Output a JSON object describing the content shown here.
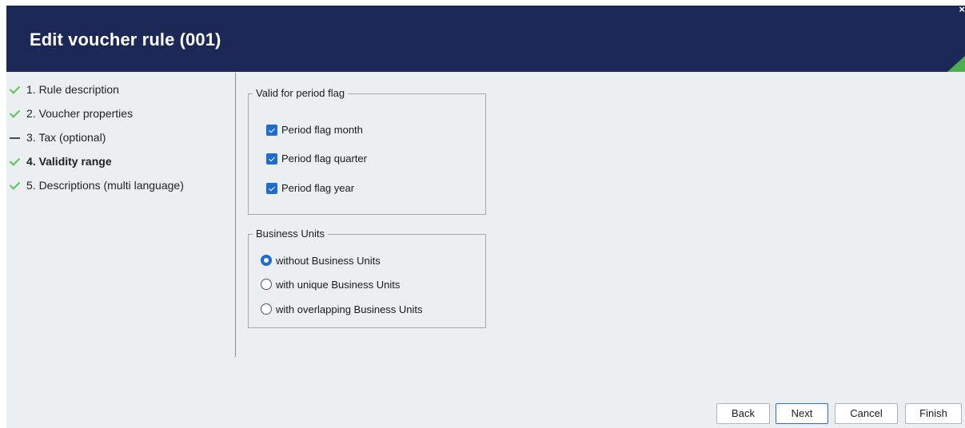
{
  "header": {
    "title": "Edit voucher rule (001)",
    "close_icon": "close-icon",
    "accent_color": "#4caf50",
    "background_color": "#1c2957"
  },
  "steps": [
    {
      "label": "1. Rule description",
      "state": "done",
      "icon": "checkmark-icon"
    },
    {
      "label": "2. Voucher properties",
      "state": "done",
      "icon": "checkmark-icon"
    },
    {
      "label": "3. Tax (optional)",
      "state": "skipped",
      "icon": "dash-icon"
    },
    {
      "label": "4. Validity range",
      "state": "current",
      "icon": "checkmark-icon"
    },
    {
      "label": "5. Descriptions (multi language)",
      "state": "done",
      "icon": "checkmark-icon"
    }
  ],
  "period_group": {
    "legend": "Valid for period flag",
    "options": [
      {
        "label": "Period flag month",
        "checked": true
      },
      {
        "label": "Period flag quarter",
        "checked": true
      },
      {
        "label": "Period flag year",
        "checked": true
      }
    ]
  },
  "business_units_group": {
    "legend": "Business Units",
    "options": [
      {
        "label": "without Business Units",
        "selected": true
      },
      {
        "label": "with unique Business Units",
        "selected": false
      },
      {
        "label": "with overlapping Business Units",
        "selected": false
      }
    ]
  },
  "buttons": {
    "back": "Back",
    "next": "Next",
    "cancel": "Cancel",
    "finish": "Finish"
  }
}
